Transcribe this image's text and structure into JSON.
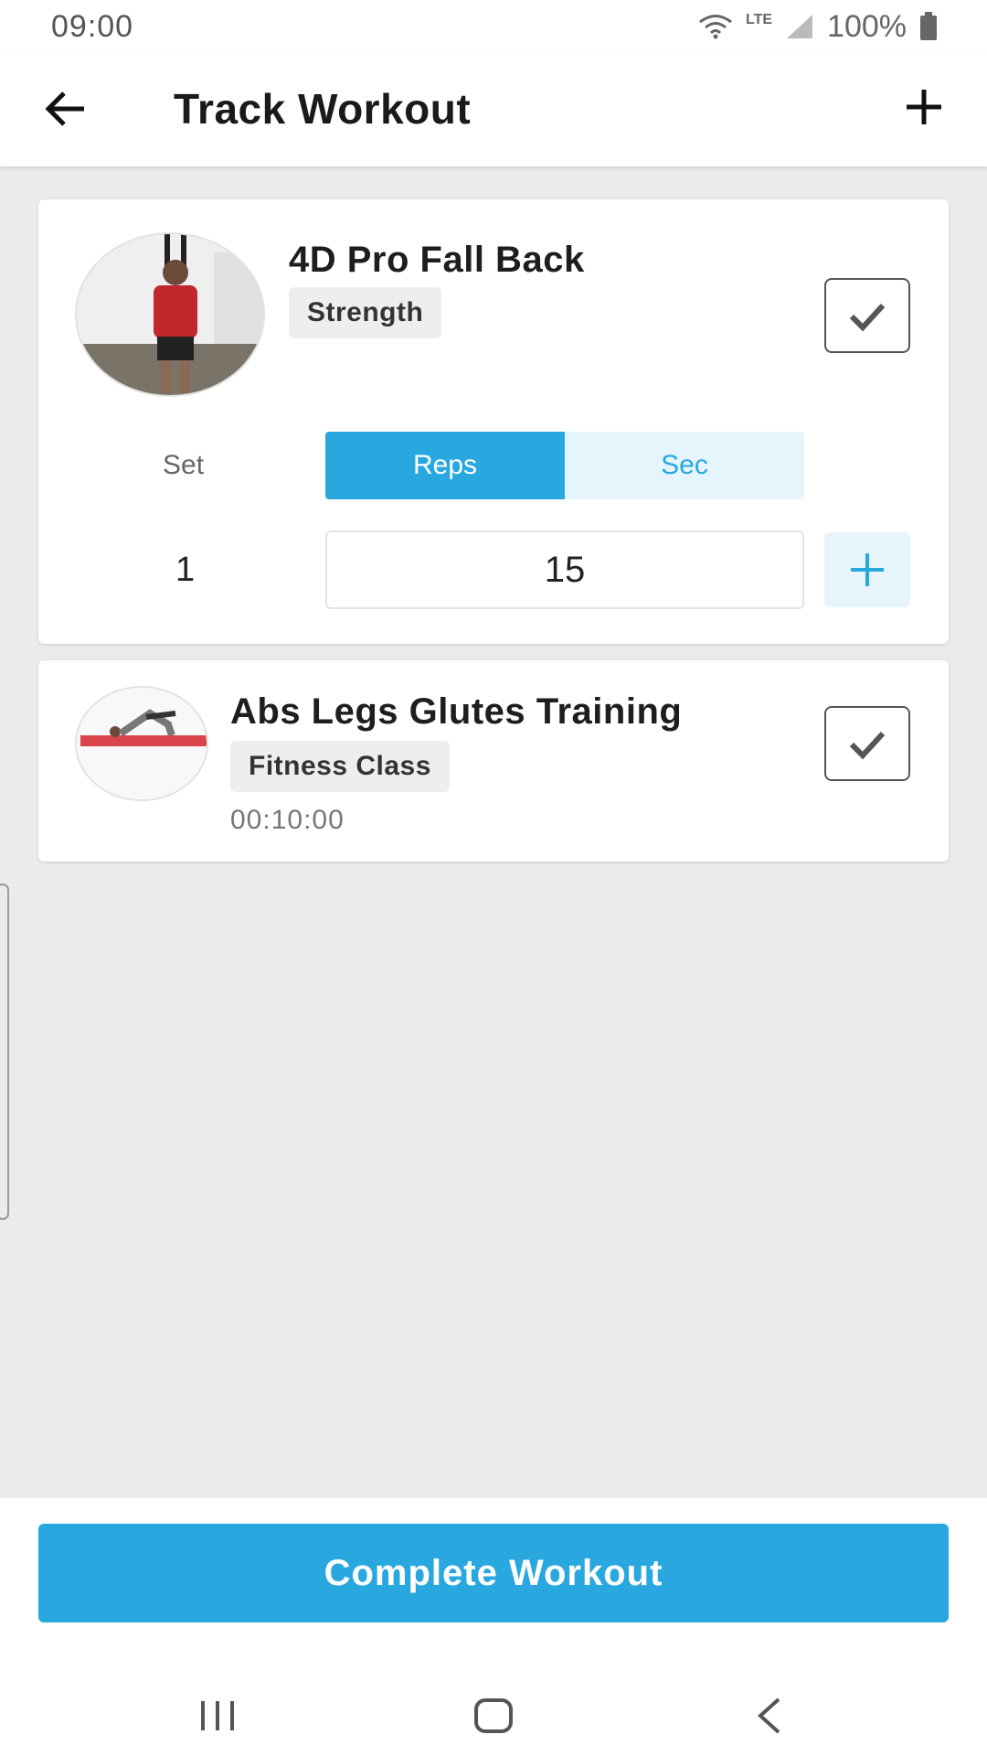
{
  "status_bar": {
    "time": "09:00",
    "network": "LTE",
    "battery": "100%",
    "icons": [
      "wifi-icon",
      "signal-icon",
      "battery-icon"
    ]
  },
  "header": {
    "title": "Track Workout",
    "back_icon": "arrow-left-icon",
    "add_icon": "plus-icon"
  },
  "exercises": [
    {
      "name": "4D Pro Fall Back",
      "category": "Strength",
      "checked": true,
      "set_label": "Set",
      "mode_options": [
        "Reps",
        "Sec"
      ],
      "selected_mode": "Reps",
      "set_number": "1",
      "value": "15"
    },
    {
      "name": "Abs Legs Glutes Training",
      "category": "Fitness Class",
      "duration": "00:10:00",
      "checked": true
    }
  ],
  "footer": {
    "complete_label": "Complete Workout"
  },
  "nav": {
    "icons": [
      "recents-icon",
      "home-icon",
      "back-chevron-icon"
    ]
  },
  "colors": {
    "accent": "#29a8e0",
    "accent_light": "#e6f5fc",
    "background": "#ebebeb",
    "card": "#ffffff"
  }
}
